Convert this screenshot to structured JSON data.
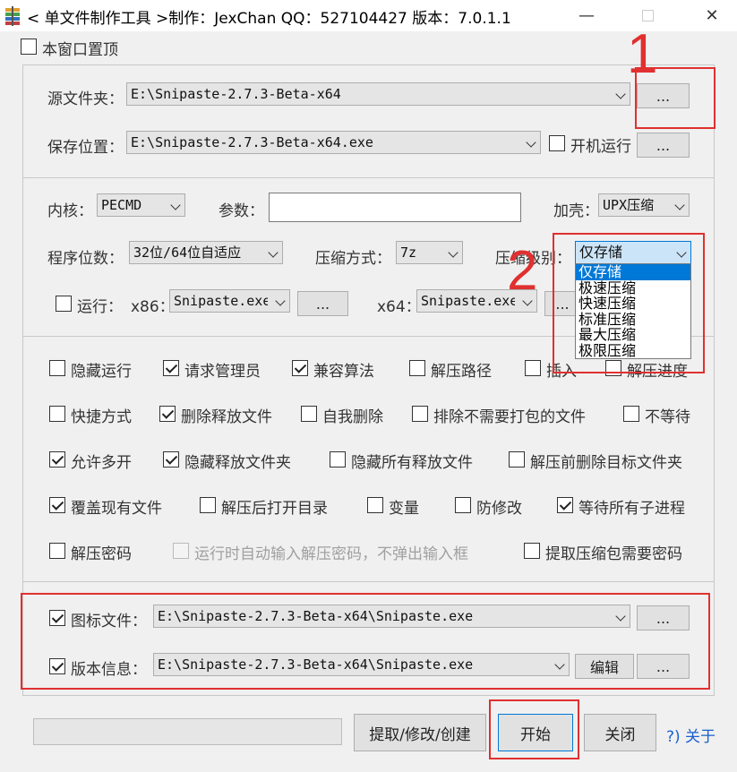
{
  "window": {
    "title": "< 单文件制作工具 >制作：JexChan  QQ：527104427  版本：7.0.1.1",
    "minimize": "—",
    "close": "✕"
  },
  "topmost": {
    "label": "本窗口置顶",
    "checked": false
  },
  "source": {
    "label": "源文件夹：",
    "value": "E:\\Snipaste-2.7.3-Beta-x64",
    "browse": "..."
  },
  "save": {
    "label": "保存位置：",
    "value": "E:\\Snipaste-2.7.3-Beta-x64.exe",
    "startup_label": "开机运行",
    "browse": "..."
  },
  "options": {
    "kernel_label": "内核：",
    "kernel_value": "PECMD",
    "params_label": "参数：",
    "params_value": "",
    "shell_label": "加壳：",
    "shell_value": "UPX压缩",
    "bits_label": "程序位数：",
    "bits_value": "32位/64位自适应",
    "compress_method_label": "压缩方式：",
    "compress_method_value": "7z",
    "compress_level_label": "压缩级别：",
    "compress_level_value": "仅存储",
    "compress_levels": [
      "仅存储",
      "极速压缩",
      "快速压缩",
      "标准压缩",
      "最大压缩",
      "极限压缩"
    ],
    "run_label": "运行：",
    "x86_label": "x86：",
    "x86_value": "Snipaste.exe",
    "x86_browse": "...",
    "x64_label": "x64：",
    "x64_value": "Snipaste.exe",
    "x64_browse": "..."
  },
  "checks": {
    "hide_run": "隐藏运行",
    "request_admin": "请求管理员",
    "compat_algo": "兼容算法",
    "extract_path": "解压路径",
    "insert": "插入",
    "extract_progress": "解压进度",
    "shortcut": "快捷方式",
    "delete_released": "删除释放文件",
    "self_delete": "自我删除",
    "exclude_files": "排除不需要打包的文件",
    "no_wait": "不等待",
    "allow_multi": "允许多开",
    "hide_release_folder": "隐藏释放文件夹",
    "hide_all_released": "隐藏所有释放文件",
    "delete_target_before": "解压前删除目标文件夹",
    "overwrite": "覆盖现有文件",
    "open_dir_after": "解压后打开目录",
    "variables": "变量",
    "anti_modify": "防修改",
    "wait_children": "等待所有子进程",
    "extract_password": "解压密码",
    "auto_password": "运行时自动输入解压密码，不弹出输入框",
    "extract_needs_password": "提取压缩包需要密码"
  },
  "resources": {
    "icon_label": "图标文件：",
    "icon_value": "E:\\Snipaste-2.7.3-Beta-x64\\Snipaste.exe",
    "icon_browse": "...",
    "version_label": "版本信息：",
    "version_value": "E:\\Snipaste-2.7.3-Beta-x64\\Snipaste.exe",
    "edit_button": "编辑",
    "version_browse": "..."
  },
  "footer": {
    "extract_button": "提取/修改/创建",
    "start_button": "开始",
    "close_button": "关闭",
    "about_link": "?) 关于"
  },
  "annotations": {
    "one": "1",
    "two": "2"
  },
  "colors": {
    "annotation_red": "#e03030",
    "selection_blue": "#0078d7",
    "link_blue": "#1a5fd0"
  }
}
